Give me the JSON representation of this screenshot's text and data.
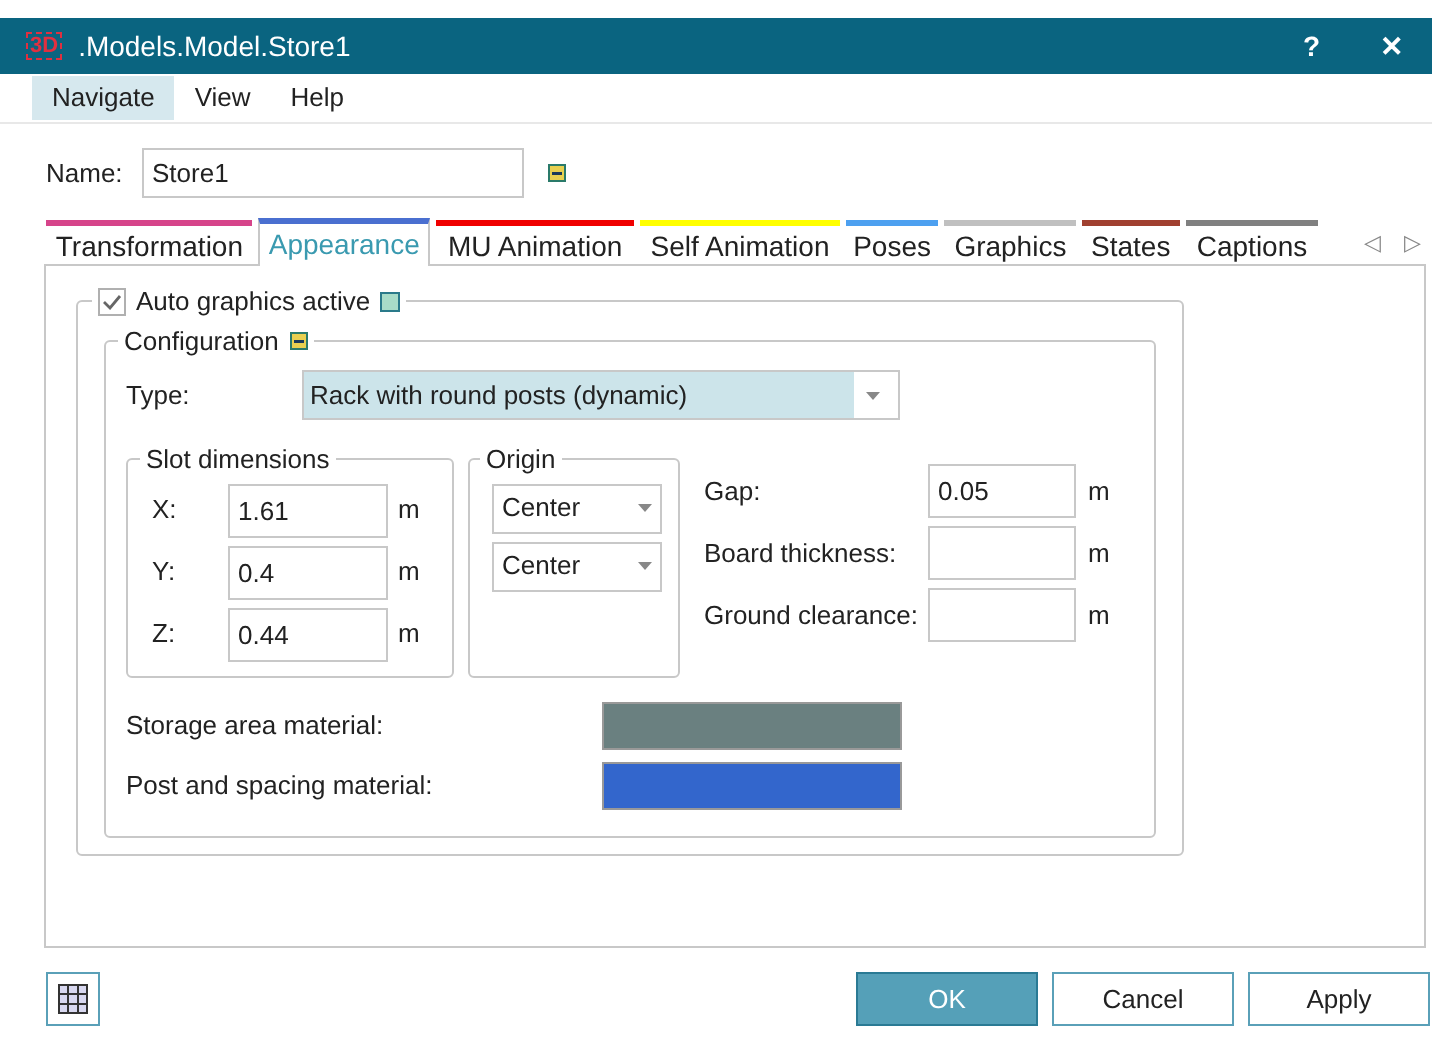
{
  "window": {
    "app_icon": "3D",
    "title": ".Models.Model.Store1",
    "help": "?",
    "close": "✕"
  },
  "menu": [
    {
      "label": "Navigate",
      "selected": true
    },
    {
      "label": "View",
      "selected": false
    },
    {
      "label": "Help",
      "selected": false
    }
  ],
  "name_field": {
    "label": "Name:",
    "value": "Store1"
  },
  "tabs": [
    {
      "label": "Transformation",
      "selected": false,
      "color": "#d6448a"
    },
    {
      "label": "Appearance",
      "selected": true,
      "color": "#4a6fd0"
    },
    {
      "label": "MU Animation",
      "selected": false,
      "color": "#f00000"
    },
    {
      "label": "Self Animation",
      "selected": false,
      "color": "#ffff00"
    },
    {
      "label": "Poses",
      "selected": false,
      "color": "#4da0f0"
    },
    {
      "label": "Graphics",
      "selected": false,
      "color": "#c0c0c0"
    },
    {
      "label": "States",
      "selected": false,
      "color": "#a04030"
    },
    {
      "label": "Captions",
      "selected": false,
      "color": "#808080"
    }
  ],
  "tab_scroll": [
    "◁",
    "▷"
  ],
  "auto_graphics": {
    "label": "Auto graphics active",
    "checked": true
  },
  "configuration": {
    "title": "Configuration",
    "type_label": "Type:",
    "type_value": "Rack with round posts (dynamic)",
    "slot_dimensions": {
      "title": "Slot dimensions",
      "rows": [
        {
          "label": "X:",
          "value": "1.61",
          "unit": "m"
        },
        {
          "label": "Y:",
          "value": "0.4",
          "unit": "m"
        },
        {
          "label": "Z:",
          "value": "0.44",
          "unit": "m"
        }
      ]
    },
    "origin": {
      "title": "Origin",
      "options": [
        "Center",
        "Center"
      ]
    },
    "extra": [
      {
        "label": "Gap:",
        "value": "0.05",
        "unit": "m"
      },
      {
        "label": "Board thickness:",
        "unit": "m"
      },
      {
        "label": "Ground clearance:",
        "unit": "m"
      }
    ],
    "materials": [
      {
        "label": "Storage area material:",
        "color": "#6a8080"
      },
      {
        "label": "Post and spacing material:",
        "color": "#3366cc"
      }
    ]
  },
  "buttons": [
    {
      "label": "OK",
      "kind": "primary"
    },
    {
      "label": "Cancel",
      "kind": "normal"
    },
    {
      "label": "Apply",
      "kind": "normal"
    }
  ]
}
